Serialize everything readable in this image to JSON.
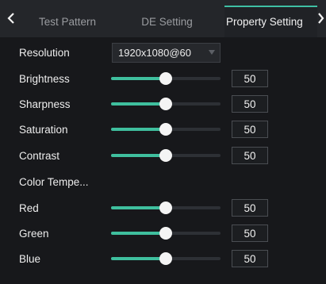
{
  "tabs": [
    {
      "label": "Test Pattern",
      "active": false
    },
    {
      "label": "DE Setting",
      "active": false
    },
    {
      "label": "Property Setting",
      "active": true
    }
  ],
  "icons": {
    "prev": "chevron-left-icon",
    "next": "chevron-right-icon"
  },
  "resolution": {
    "label": "Resolution",
    "value": "1920x1080@60"
  },
  "color_temp_label": "Color Tempe...",
  "sliders": {
    "brightness": {
      "label": "Brightness",
      "value": "50",
      "level": 0.5
    },
    "sharpness": {
      "label": "Sharpness",
      "value": "50",
      "level": 0.5
    },
    "saturation": {
      "label": "Saturation",
      "value": "50",
      "level": 0.5
    },
    "contrast": {
      "label": "Contrast",
      "value": "50",
      "level": 0.5
    },
    "red": {
      "label": "Red",
      "value": "50",
      "level": 0.5
    },
    "green": {
      "label": "Green",
      "value": "50",
      "level": 0.5
    },
    "blue": {
      "label": "Blue",
      "value": "50",
      "level": 0.5
    }
  },
  "colors": {
    "accent": "#3fbf9e",
    "background": "#17181b",
    "tab_bg": "#24262a"
  }
}
